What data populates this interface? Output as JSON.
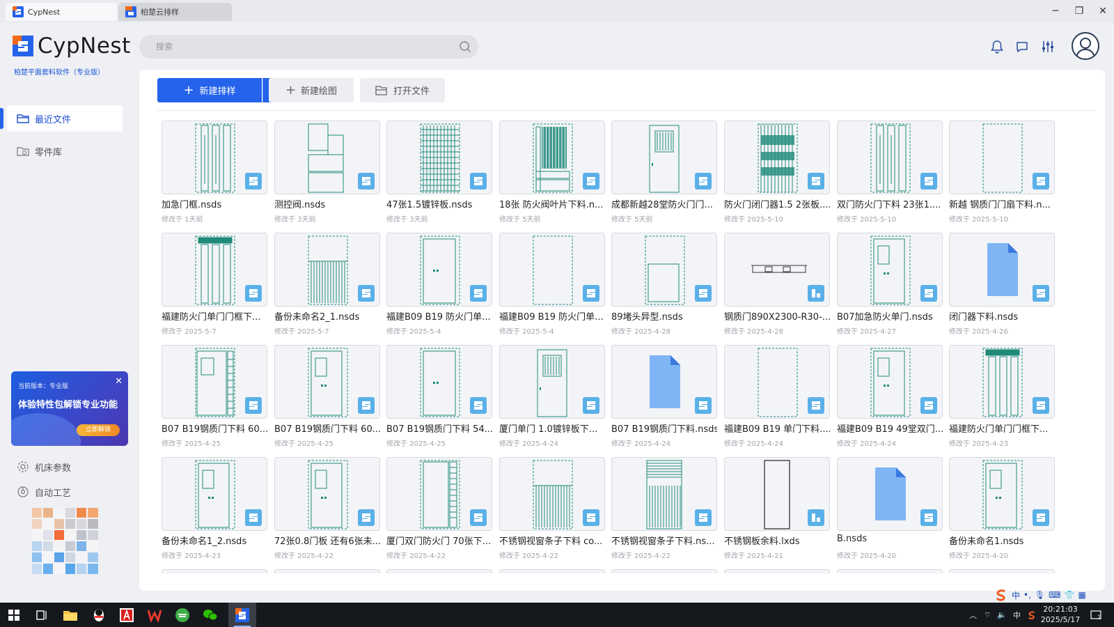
{
  "window": {
    "tabs": [
      {
        "label": "CypNest",
        "active": true
      },
      {
        "label": "柏楚云排样",
        "active": false
      }
    ]
  },
  "header": {
    "brand": "CypNest",
    "subtitle": "柏楚平面套料软件（专业版）",
    "search_placeholder": "搜索",
    "icons": [
      "bell-icon",
      "message-icon",
      "settings-sliders-icon",
      "avatar"
    ]
  },
  "sidebar": {
    "items": [
      {
        "label": "最近文件",
        "icon": "folder-open-icon",
        "active": true
      },
      {
        "label": "零件库",
        "icon": "folder-icon",
        "active": false
      }
    ],
    "bottom_items": [
      {
        "label": "机床参数",
        "icon": "gear-icon"
      },
      {
        "label": "自动工艺",
        "icon": "auto-process-icon"
      }
    ],
    "promo": {
      "version_line": "当前版本：专业版",
      "headline": "体验特性包解锁专业功能",
      "button": "立即解锁"
    }
  },
  "toolbar": {
    "new_nest": "新建排样",
    "new_drawing": "新建绘图",
    "open_file": "打开文件"
  },
  "colors": {
    "primary": "#2563eb",
    "drawing_line": "#1f8a7a",
    "badge": "#5ab0e8",
    "doc_icon": "#7fb5f5"
  },
  "files": [
    {
      "name": "加急门框.nsds",
      "modified": "修改于 1天前",
      "kind": "frame3"
    },
    {
      "name": "测控阀.nsds",
      "modified": "修改于 3天前",
      "kind": "valve"
    },
    {
      "name": "47张1.5镀锌板.nsds",
      "modified": "修改于 3天前",
      "kind": "dense"
    },
    {
      "name": "18张 防火阀叶片下料.n...",
      "modified": "修改于 5天前",
      "kind": "filledstrips"
    },
    {
      "name": "成都新越28堂防火门门...",
      "modified": "修改于 5天前",
      "kind": "doorgrille"
    },
    {
      "name": "防火门闭门器1.5 2张板....",
      "modified": "修改于 2025-5-10",
      "kind": "mixeddense"
    },
    {
      "name": "双门防火门下料 23张1....",
      "modified": "修改于 2025-5-10",
      "kind": "frame3"
    },
    {
      "name": "新越 钢质门门扇下料.n...",
      "modified": "修改于 2025-5-10",
      "kind": "emptysheet"
    },
    {
      "name": "福建防火门单门门框下...",
      "modified": "修改于 2025-5-7",
      "kind": "frame3top"
    },
    {
      "name": "备份未命名2_1.nsds",
      "modified": "修改于 2025-5-7",
      "kind": "bottomstrips"
    },
    {
      "name": "福建B09 B19 防火门单...",
      "modified": "修改于 2025-5-4",
      "kind": "door"
    },
    {
      "name": "福建B09 B19 防火门单...",
      "modified": "修改于 2025-5-4",
      "kind": "emptysheet"
    },
    {
      "name": "89堵头异型.nsds",
      "modified": "修改于 2025-4-28",
      "kind": "innerrect"
    },
    {
      "name": "钢质门890X2300-R30-...",
      "modified": "修改于 2025-4-28",
      "kind": "wide",
      "badge": "lxds"
    },
    {
      "name": "B07加急防火单门.nsds",
      "modified": "修改于 2025-4-27",
      "kind": "doorwindow"
    },
    {
      "name": "闭门器下料.nsds",
      "modified": "修改于 2025-4-26",
      "kind": "doc"
    },
    {
      "name": "B07 B19钢质门下料 60...",
      "modified": "修改于 2025-4-25",
      "kind": "doorwindowside"
    },
    {
      "name": "B07 B19钢质门下料 60...",
      "modified": "修改于 2025-4-25",
      "kind": "doorwindow"
    },
    {
      "name": "B07 B19钢质门下料 54...",
      "modified": "修改于 2025-4-25",
      "kind": "door"
    },
    {
      "name": "厦门单门 1.0镀锌板下...",
      "modified": "修改于 2025-4-24",
      "kind": "doorgrille"
    },
    {
      "name": "B07 B19钢质门下料.nsds",
      "modified": "修改于 2025-4-24",
      "kind": "doc"
    },
    {
      "name": "福建B09 B19 单门下料....",
      "modified": "修改于 2025-4-24",
      "kind": "emptysheet"
    },
    {
      "name": "福建B09 B19 49堂双门...",
      "modified": "修改于 2025-4-24",
      "kind": "doorwindow"
    },
    {
      "name": "福建防火门单门门框下...",
      "modified": "修改于 2025-4-23",
      "kind": "frame3top"
    },
    {
      "name": "备份未命名1_2.nsds",
      "modified": "修改于 2025-4-23",
      "kind": "doorwindow"
    },
    {
      "name": "72张0.8门板 还有6张未...",
      "modified": "修改于 2025-4-22",
      "kind": "doorwindow"
    },
    {
      "name": "厦门双门防火门 70张下...",
      "modified": "修改于 2025-4-22",
      "kind": "doorside"
    },
    {
      "name": "不锈钢视窗条子下料 co...",
      "modified": "修改于 2025-4-22",
      "kind": "bottomstrips"
    },
    {
      "name": "不锈钢视窗条子下料.ns...",
      "modified": "修改于 2025-4-22",
      "kind": "topbottomstrips"
    },
    {
      "name": "不锈钢板余料.lxds",
      "modified": "修改于 2025-4-21",
      "kind": "blackrect",
      "badge": "lxds"
    },
    {
      "name": "B.nsds",
      "modified": "修改于 2025-4-20",
      "kind": "doc"
    },
    {
      "name": "备份未命名1.nsds",
      "modified": "修改于 2025-4-20",
      "kind": "doorwindow"
    }
  ],
  "ime": {
    "lang": "中"
  },
  "taskbar": {
    "time": "20:21:03",
    "date": "2025/5/17",
    "tray_lang": "中",
    "notifications": "1"
  }
}
